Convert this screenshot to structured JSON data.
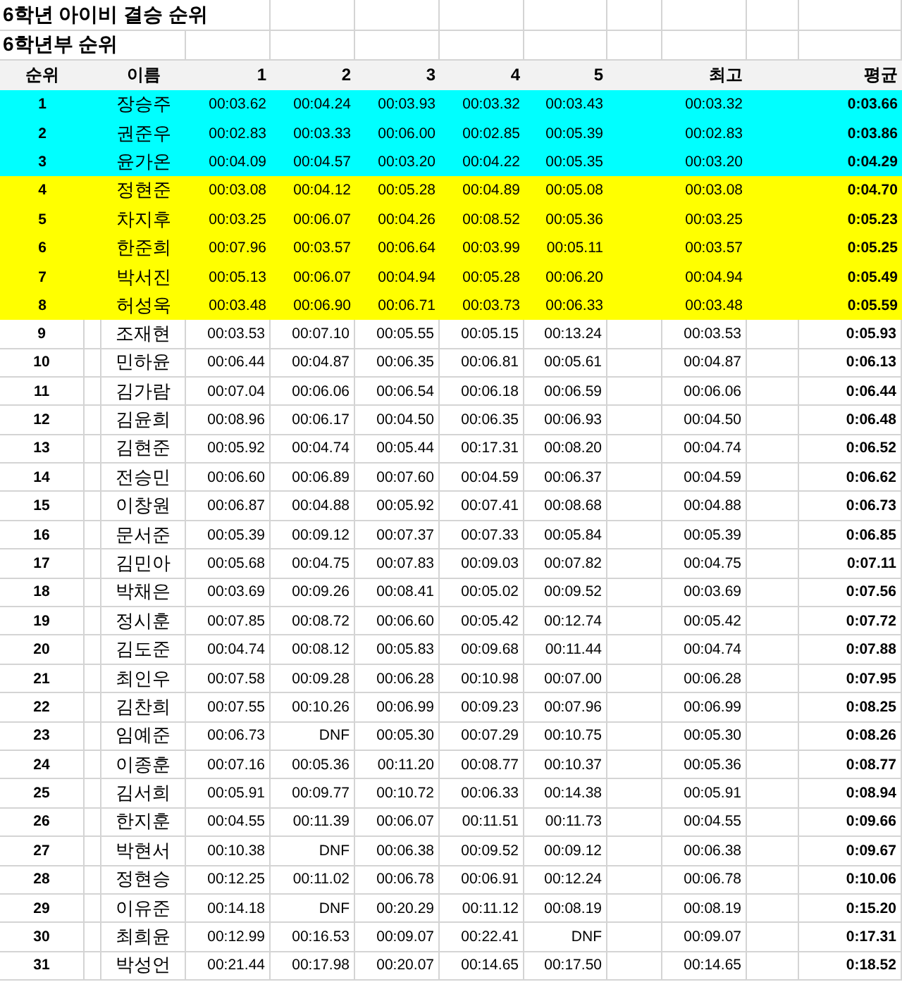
{
  "sheet": {
    "titles": [
      "6학년 아이비 결승 순위",
      "6학년부 순위"
    ],
    "columns": [
      "순위",
      "이름",
      "1",
      "2",
      "3",
      "4",
      "5",
      "최고",
      "평균"
    ],
    "rows": [
      {
        "rank": "1",
        "name": "장승주",
        "times": [
          "00:03.62",
          "00:04.24",
          "00:03.93",
          "00:03.32",
          "00:03.43"
        ],
        "best": "00:03.32",
        "average": "0:03.66",
        "color": "#00ffff"
      },
      {
        "rank": "2",
        "name": "권준우",
        "times": [
          "00:02.83",
          "00:03.33",
          "00:06.00",
          "00:02.85",
          "00:05.39"
        ],
        "best": "00:02.83",
        "average": "0:03.86",
        "color": "#00ffff"
      },
      {
        "rank": "3",
        "name": "윤가온",
        "times": [
          "00:04.09",
          "00:04.57",
          "00:03.20",
          "00:04.22",
          "00:05.35"
        ],
        "best": "00:03.20",
        "average": "0:04.29",
        "color": "#00ffff"
      },
      {
        "rank": "4",
        "name": "정현준",
        "times": [
          "00:03.08",
          "00:04.12",
          "00:05.28",
          "00:04.89",
          "00:05.08"
        ],
        "best": "00:03.08",
        "average": "0:04.70",
        "color": "#ffff00"
      },
      {
        "rank": "5",
        "name": "차지후",
        "times": [
          "00:03.25",
          "00:06.07",
          "00:04.26",
          "00:08.52",
          "00:05.36"
        ],
        "best": "00:03.25",
        "average": "0:05.23",
        "color": "#ffff00"
      },
      {
        "rank": "6",
        "name": "한준희",
        "times": [
          "00:07.96",
          "00:03.57",
          "00:06.64",
          "00:03.99",
          "00:05.11"
        ],
        "best": "00:03.57",
        "average": "0:05.25",
        "color": "#ffff00"
      },
      {
        "rank": "7",
        "name": "박서진",
        "times": [
          "00:05.13",
          "00:06.07",
          "00:04.94",
          "00:05.28",
          "00:06.20"
        ],
        "best": "00:04.94",
        "average": "0:05.49",
        "color": "#ffff00"
      },
      {
        "rank": "8",
        "name": "허성욱",
        "times": [
          "00:03.48",
          "00:06.90",
          "00:06.71",
          "00:03.73",
          "00:06.33"
        ],
        "best": "00:03.48",
        "average": "0:05.59",
        "color": "#ffff00"
      },
      {
        "rank": "9",
        "name": "조재현",
        "times": [
          "00:03.53",
          "00:07.10",
          "00:05.55",
          "00:05.15",
          "00:13.24"
        ],
        "best": "00:03.53",
        "average": "0:05.93"
      },
      {
        "rank": "10",
        "name": "민하윤",
        "times": [
          "00:06.44",
          "00:04.87",
          "00:06.35",
          "00:06.81",
          "00:05.61"
        ],
        "best": "00:04.87",
        "average": "0:06.13"
      },
      {
        "rank": "11",
        "name": "김가람",
        "times": [
          "00:07.04",
          "00:06.06",
          "00:06.54",
          "00:06.18",
          "00:06.59"
        ],
        "best": "00:06.06",
        "average": "0:06.44"
      },
      {
        "rank": "12",
        "name": "김윤희",
        "times": [
          "00:08.96",
          "00:06.17",
          "00:04.50",
          "00:06.35",
          "00:06.93"
        ],
        "best": "00:04.50",
        "average": "0:06.48"
      },
      {
        "rank": "13",
        "name": "김현준",
        "times": [
          "00:05.92",
          "00:04.74",
          "00:05.44",
          "00:17.31",
          "00:08.20"
        ],
        "best": "00:04.74",
        "average": "0:06.52"
      },
      {
        "rank": "14",
        "name": "전승민",
        "times": [
          "00:06.60",
          "00:06.89",
          "00:07.60",
          "00:04.59",
          "00:06.37"
        ],
        "best": "00:04.59",
        "average": "0:06.62"
      },
      {
        "rank": "15",
        "name": "이창원",
        "times": [
          "00:06.87",
          "00:04.88",
          "00:05.92",
          "00:07.41",
          "00:08.68"
        ],
        "best": "00:04.88",
        "average": "0:06.73"
      },
      {
        "rank": "16",
        "name": "문서준",
        "times": [
          "00:05.39",
          "00:09.12",
          "00:07.37",
          "00:07.33",
          "00:05.84"
        ],
        "best": "00:05.39",
        "average": "0:06.85"
      },
      {
        "rank": "17",
        "name": "김민아",
        "times": [
          "00:05.68",
          "00:04.75",
          "00:07.83",
          "00:09.03",
          "00:07.82"
        ],
        "best": "00:04.75",
        "average": "0:07.11"
      },
      {
        "rank": "18",
        "name": "박채은",
        "times": [
          "00:03.69",
          "00:09.26",
          "00:08.41",
          "00:05.02",
          "00:09.52"
        ],
        "best": "00:03.69",
        "average": "0:07.56"
      },
      {
        "rank": "19",
        "name": "정시훈",
        "times": [
          "00:07.85",
          "00:08.72",
          "00:06.60",
          "00:05.42",
          "00:12.74"
        ],
        "best": "00:05.42",
        "average": "0:07.72"
      },
      {
        "rank": "20",
        "name": "김도준",
        "times": [
          "00:04.74",
          "00:08.12",
          "00:05.83",
          "00:09.68",
          "00:11.44"
        ],
        "best": "00:04.74",
        "average": "0:07.88"
      },
      {
        "rank": "21",
        "name": "최인우",
        "times": [
          "00:07.58",
          "00:09.28",
          "00:06.28",
          "00:10.98",
          "00:07.00"
        ],
        "best": "00:06.28",
        "average": "0:07.95"
      },
      {
        "rank": "22",
        "name": "김찬희",
        "times": [
          "00:07.55",
          "00:10.26",
          "00:06.99",
          "00:09.23",
          "00:07.96"
        ],
        "best": "00:06.99",
        "average": "0:08.25"
      },
      {
        "rank": "23",
        "name": "임예준",
        "times": [
          "00:06.73",
          "DNF",
          "00:05.30",
          "00:07.29",
          "00:10.75"
        ],
        "best": "00:05.30",
        "average": "0:08.26"
      },
      {
        "rank": "24",
        "name": "이종훈",
        "times": [
          "00:07.16",
          "00:05.36",
          "00:11.20",
          "00:08.77",
          "00:10.37"
        ],
        "best": "00:05.36",
        "average": "0:08.77"
      },
      {
        "rank": "25",
        "name": "김서희",
        "times": [
          "00:05.91",
          "00:09.77",
          "00:10.72",
          "00:06.33",
          "00:14.38"
        ],
        "best": "00:05.91",
        "average": "0:08.94"
      },
      {
        "rank": "26",
        "name": "한지훈",
        "times": [
          "00:04.55",
          "00:11.39",
          "00:06.07",
          "00:11.51",
          "00:11.73"
        ],
        "best": "00:04.55",
        "average": "0:09.66"
      },
      {
        "rank": "27",
        "name": "박현서",
        "times": [
          "00:10.38",
          "DNF",
          "00:06.38",
          "00:09.52",
          "00:09.12"
        ],
        "best": "00:06.38",
        "average": "0:09.67"
      },
      {
        "rank": "28",
        "name": "정현승",
        "times": [
          "00:12.25",
          "00:11.02",
          "00:06.78",
          "00:06.91",
          "00:12.24"
        ],
        "best": "00:06.78",
        "average": "0:10.06"
      },
      {
        "rank": "29",
        "name": "이유준",
        "times": [
          "00:14.18",
          "DNF",
          "00:20.29",
          "00:11.12",
          "00:08.19"
        ],
        "best": "00:08.19",
        "average": "0:15.20"
      },
      {
        "rank": "30",
        "name": "최희윤",
        "times": [
          "00:12.99",
          "00:16.53",
          "00:09.07",
          "00:22.41",
          "DNF"
        ],
        "best": "00:09.07",
        "average": "0:17.31"
      },
      {
        "rank": "31",
        "name": "박성언",
        "times": [
          "00:21.44",
          "00:17.98",
          "00:20.07",
          "00:14.65",
          "00:17.50"
        ],
        "best": "00:14.65",
        "average": "0:18.52"
      }
    ]
  }
}
